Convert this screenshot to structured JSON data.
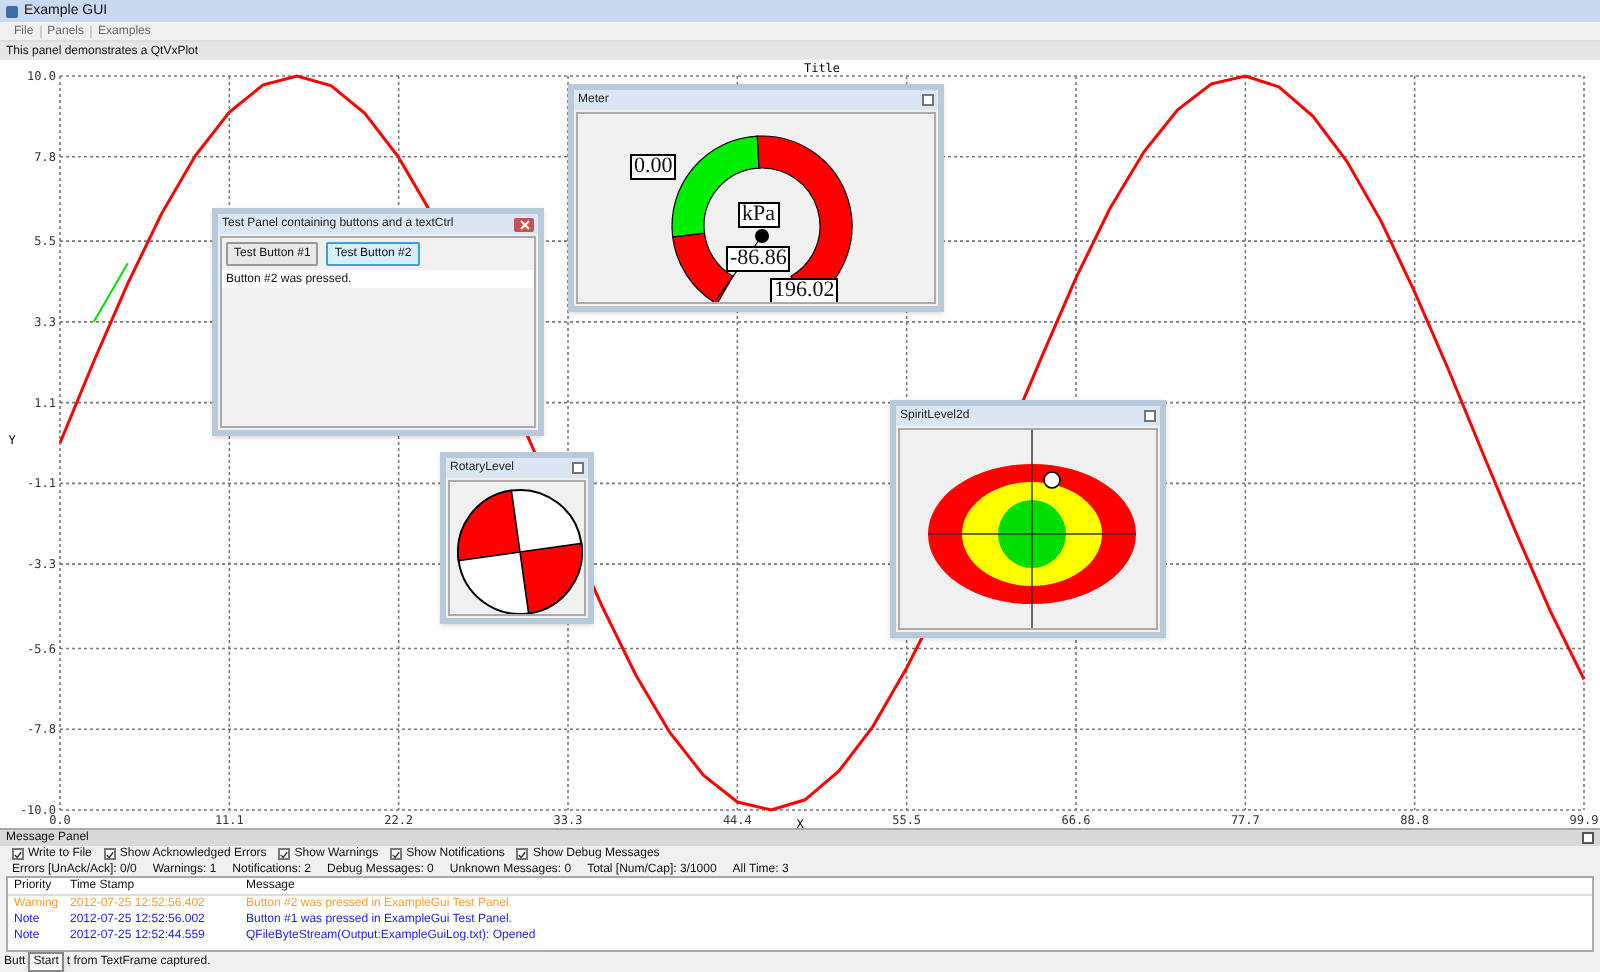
{
  "window": {
    "title": "Example GUI"
  },
  "menu": [
    "File",
    "Panels",
    "Examples"
  ],
  "panel_description": "This panel demonstrates a QtVxPlot",
  "plot": {
    "chart_data": {
      "type": "line",
      "title": "Title",
      "xlabel": "X",
      "ylabel": "Y",
      "x": [
        0,
        2.22,
        4.44,
        6.66,
        8.88,
        11.1,
        13.32,
        15.54,
        17.76,
        19.98,
        22.2,
        24.1,
        34.9,
        35.52,
        37.74,
        39.96,
        42.18,
        44.4,
        46.62,
        48.84,
        51.06,
        53.28,
        55.5,
        56.5,
        63.2,
        64.38,
        66.6,
        68.82,
        71.04,
        73.26,
        75.48,
        77.7,
        79.92,
        82.14,
        84.36,
        86.58,
        88.8,
        91.02,
        93.24,
        95.46,
        97.68,
        99.9
      ],
      "series": [
        {
          "color": "#ff0000",
          "values": [
            0,
            2.23,
            4.35,
            6.25,
            7.83,
            9.02,
            9.76,
            10.0,
            9.74,
            8.98,
            7.78,
            6.43,
            -3.86,
            -4.43,
            -6.32,
            -7.88,
            -9.05,
            -9.78,
            -10.0,
            -9.72,
            -8.94,
            -7.73,
            -6.13,
            -5.3,
            1.22,
            2.38,
            4.5,
            6.38,
            7.93,
            9.08,
            9.79,
            10.0,
            9.7,
            8.9,
            7.67,
            6.06,
            4.12,
            1.99,
            -0.25,
            -2.46,
            -4.57,
            -6.44
          ]
        },
        {
          "color": "#00dd00",
          "values": [
            null,
            3.3,
            4.9,
            null,
            null,
            null,
            null,
            null,
            null,
            null,
            null,
            null,
            null,
            null,
            null,
            null,
            null,
            null,
            null,
            null,
            null,
            null,
            null,
            null,
            null,
            null,
            null,
            null,
            null,
            null,
            null,
            null,
            null,
            null,
            null,
            null,
            null,
            null,
            null,
            null,
            null,
            null
          ]
        }
      ],
      "grid": true,
      "xlim": [
        0,
        99.9
      ],
      "ylim": [
        -10,
        10
      ],
      "xticks": [
        {
          "value": 0,
          "label": "0.0"
        },
        {
          "value": 11.1,
          "label": "11.1"
        },
        {
          "value": 22.2,
          "label": "22.2"
        },
        {
          "value": 33.3,
          "label": "33.3"
        },
        {
          "value": 44.4,
          "label": "44.4"
        },
        {
          "value": 55.5,
          "label": "55.5"
        },
        {
          "value": 66.6,
          "label": "66.6"
        },
        {
          "value": 77.7,
          "label": "77.7"
        },
        {
          "value": 88.8,
          "label": "88.8"
        },
        {
          "value": 99.9,
          "label": "99.9"
        }
      ],
      "yticks": [
        {
          "value": 10,
          "label": "10.0"
        },
        {
          "value": 7.8,
          "label": "7.8"
        },
        {
          "value": 5.5,
          "label": "5.5"
        },
        {
          "value": 3.3,
          "label": "3.3"
        },
        {
          "value": 1.1,
          "label": "1.1"
        },
        {
          "value": -1.1,
          "label": "-1.1"
        },
        {
          "value": -3.3,
          "label": "-3.3"
        },
        {
          "value": -5.6,
          "label": "-5.6"
        },
        {
          "value": -7.8,
          "label": "-7.8"
        },
        {
          "value": -10,
          "label": "-10.0"
        }
      ]
    }
  },
  "test_panel": {
    "title": "Test Panel containing buttons and a textCtrl",
    "buttons": [
      {
        "label": "Test Button #1",
        "selected": false
      },
      {
        "label": "Test Button #2",
        "selected": true
      }
    ],
    "text": "Button #2 was pressed."
  },
  "meter": {
    "title": "Meter",
    "min_label": "0.00",
    "unit": "kPa",
    "value": "-86.86",
    "max_label": "196.02"
  },
  "rotary_level": {
    "title": "RotaryLevel"
  },
  "spirit_level": {
    "title": "SpiritLevel2d"
  },
  "message_panel": {
    "title": "Message Panel",
    "options": [
      {
        "label": "Write to File",
        "checked": true
      },
      {
        "label": "Show Acknowledged Errors",
        "checked": true
      },
      {
        "label": "Show Warnings",
        "checked": true
      },
      {
        "label": "Show Notifications",
        "checked": true
      },
      {
        "label": "Show Debug Messages",
        "checked": true
      }
    ],
    "counters": [
      "Errors [UnAck/Ack]: 0/0",
      "Warnings: 1",
      "Notifications: 2",
      "Debug Messages: 0",
      "Unknown Messages: 0",
      "Total [Num/Cap]: 3/1000",
      "All Time: 3"
    ],
    "table": {
      "columns": [
        "Priority",
        "Time Stamp",
        "Message"
      ],
      "rows": [
        {
          "color": "#f0a030",
          "cells": [
            "Warning",
            "2012-07-25 12:52:56.402",
            "Button #2 was pressed in ExampleGui Test Panel."
          ]
        },
        {
          "color": "#2020e0",
          "cells": [
            "Note",
            "2012-07-25 12:52:56.002",
            "Button #1 was pressed in ExampleGui Test Panel."
          ]
        },
        {
          "color": "#2020e0",
          "cells": [
            "Note",
            "2012-07-25 12:52:44.559",
            "QFileByteStream(Output:ExampleGuiLog.txt): Opened"
          ]
        }
      ]
    }
  },
  "status_bar": {
    "text_before": "Butt",
    "tooltip": "Start",
    "text_after": "t from TextFrame captured."
  }
}
